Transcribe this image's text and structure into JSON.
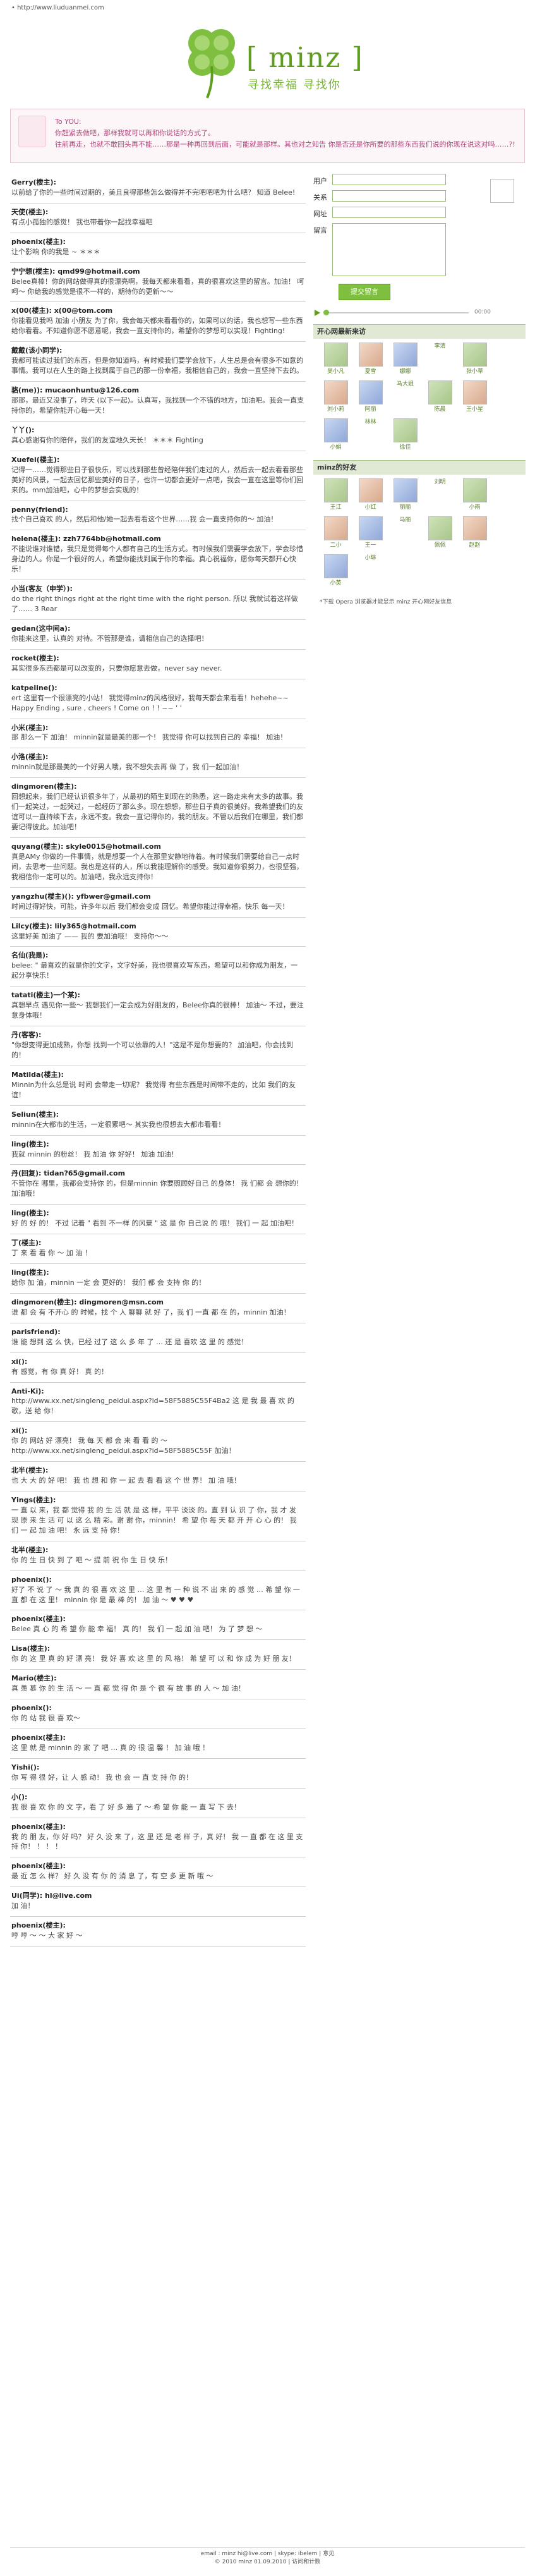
{
  "site": {
    "url": "• http://www.liuduanmei.com",
    "brand": "[ minz ]",
    "slogan": "寻找幸福 寻找你"
  },
  "notice": {
    "title": "To YOU:",
    "lines": [
      "你赶紧去做吧，那样我就可以再和你说话的方式了。",
      "往前再走，也就不敢回头再不能……那是一种再回到后面，可能就是那样。其也对之知告 你是否还是你所要的那些东西我们说的你现在说这对吗……?!"
    ]
  },
  "form": {
    "name_label": "用户",
    "email_label": "关系",
    "site_label": "网址",
    "message_label": "留言",
    "submit_label": "提交留言"
  },
  "player": {
    "time": "00:00"
  },
  "friends_title": "开心网最新来访",
  "friends": [
    "吴小凡",
    "夏雪",
    "娜娜",
    "李清",
    "张小草",
    "刘小莉",
    "阿丽",
    "马大姐",
    "陈晨",
    "王小星",
    "小娟",
    "林林",
    "徐佳"
  ],
  "minz_title": "minz的好友",
  "minz_friends": [
    "王江",
    "小红",
    "丽丽",
    "刘明",
    "小雨",
    "二小",
    "王一",
    "马丽",
    "佩佩",
    "赵赵",
    "小英",
    "小琳"
  ],
  "sidenote": "*下载 Opera 浏览器才能显示 minz 开心网好友信息",
  "entries": [
    {
      "who": "Gerry(楼主):",
      "text": "以前给了你的一些时间过期的，美且良得那些怎么做得并不完吧吧吧为什么吧？ 知道 Belee!"
    },
    {
      "who": "天使(楼主):",
      "text": "有点小孤独的感觉！ 我也带着你一起找幸福吧"
    },
    {
      "who": "phoenix(楼主):",
      "text": "让个影响 你的我是 ~ ＊＊＊"
    },
    {
      "who": "宁宁想(楼主): qmd99@hotmail.com",
      "text": "Belee真棒！你的网站做得真的很漂亮啊，我每天都来看看，真的很喜欢这里的留言。加油！ 呵呵～ 你给我的感觉是很不一样的，期待你的更新～～"
    },
    {
      "who": "x(00(楼主): x(00@tom.com",
      "text": "你能看见我吗 加油 小朋友 为了你，我会每天都来看看你的，如果可以的话，我也想写一些东西给你看看。不知道你愿不愿意呢，我会一直支持你的，希望你的梦想可以实现！Fighting!"
    },
    {
      "who": "戴戴(该小同学):",
      "text": "我都可能读过我们的东西，但是你知道吗，有时候我们要学会放下，人生总是会有很多不如意的事情。我可以在人生的路上找到属于自己的那一份幸福，我相信自己的，我会一直坚持下去的。"
    },
    {
      "who": "骆(me)):  mucaonhuntu@126.com",
      "text": "那那，最近又没事了，昨天 (以下一起)。认真写，我找到一个不错的地方，加油吧。我会一直支持你的，希望你能开心每一天！"
    },
    {
      "who": "丫丫():",
      "text": "真心感谢有你的陪伴，我们的友谊地久天长！ ＊＊＊ Fighting"
    },
    {
      "who": "Xuefei(楼主):",
      "text": "记得一……觉得那些日子很快乐，可以找到那些曾经陪伴我们走过的人，然后去一起去看看那些美好的风景，一起去回忆那些美好的日子，也许一切都会更好一点吧，我会一直在这里等你们回来的。mm加油吧，心中的梦想会实现的！"
    },
    {
      "who": "penny(friend):",
      "text": "找个自己喜欢 的人，然后和他/她一起去看看这个世界……我 会一直支持你的～ 加油！"
    },
    {
      "who": "helena(楼主): zzh7764bb@hotmail.com",
      "text": "不能说谁对谁错，我只是觉得每个人都有自己的生活方式。有时候我们需要学会放下，学会珍惜身边的人。你是一个很好的人，希望你能找到属于你的幸福。真心祝福你，愿你每天都开心快乐！"
    },
    {
      "who": "小当(客友（申学）):",
      "text": "do the right things right at the right time with the right person. 所以 我就试着这样做了…… 3 Rear"
    },
    {
      "who": "gedan(这中间a):",
      "text": "你能来这里，认真的 对待。不管那是谁，请相信自己的选择吧！"
    },
    {
      "who": "rocket(楼主):",
      "text": "其实很多东西都是可以改变的，只要你愿意去做，never say never."
    },
    {
      "who": "katpeline(): ",
      "text": "ert 这里有一个很漂亮的小站！ 我觉得minz的风格很好，我每天都会来看看！hehehe~~ Happy Ending , sure , cheers ! Come on ! ! ~~ ' '"
    },
    {
      "who": "小米(楼主):",
      "text": "那 那么一下 加油！ minnin就是最美的那一个！ 我觉得 你可以找到自己的 幸福！ 加油！"
    },
    {
      "who": "小洛(楼主):",
      "text": "minnin就是那最美的一个好男人哦，我不想失去再 做 了，我 们一起加油！"
    },
    {
      "who": "dingmoren(楼主):",
      "text": "回想起来，我们已经认识很多年了，从最初的陌生到现在的熟悉，这一路走来有太多的故事。我们一起笑过，一起哭过，一起经历了那么多。现在想想，那些日子真的很美好。我希望我们的友谊可以一直持续下去，永远不变。我会一直记得你的，我的朋友。不管以后我们在哪里，我们都要记得彼此。加油吧！"
    },
    {
      "who": "quyang(楼主): skyle0015@hotmail.com",
      "text": "真是AMy 你做的一件事情，就是想要一个人在那里安静地待着。有时候我们需要给自己一点时间，去思考一些问题。我也是这样的人，所以我能理解你的感受。我知道你很努力，也很坚强，我相信你一定可以的。加油吧，我永远支持你！"
    },
    {
      "who": "yangzhu(楼主)(): yfbwer@gmail.com",
      "text": "时间过得好快，可能，许多年以后 我们都会变成 回忆。希望你能过得幸福，快乐 每一天！"
    },
    {
      "who": "Lilcy(楼主): lily365@hotmail.com",
      "text": "这里好美 加油了 —— 我的 要加油哦！ 支持你～～"
    },
    {
      "who": "名仙(我是):",
      "text": "belee: \" 最喜欢的就是你的文字，文字好美，我也很喜欢写东西，希望可以和你成为朋友，一起分享快乐！"
    },
    {
      "who": "tatati(楼主)一个某):",
      "text": "真想早点 遇见你一些～ 我想我们一定会成为好朋友的，Belee你真的很棒！ 加油～ 不过，要注意身体哦！"
    },
    {
      "who": "丹(客客):",
      "text": "\"你想变得更加成熟，你想 找到一个可以依靠的人！\"这是不是你想要的？ 加油吧，你会找到的！"
    },
    {
      "who": "Matilda(楼主):",
      "text": "Minnin为什么总是说 时间 会带走一切呢？ 我觉得 有些东西是时间带不走的，比如 我们的友谊！"
    },
    {
      "who": "Seliun(楼主):",
      "text": "minnin在大都市的生活，一定很累吧～ 其实我也很想去大都市看看！"
    },
    {
      "who": "ling(楼主):",
      "text": "我就 minnin 的粉丝！ 我 加油 你 好好！ 加油 加油！"
    },
    {
      "who": "丹(回复): tidan?65@gmail.com",
      "text": "不管你在 哪里，我都会支持你 的，但是minnin 你要照顾好自己 的身体！ 我 们都 会 想你的！ 加油哦！"
    },
    {
      "who": "ling(楼主):",
      "text": "好 的 好 的！ 不过 记着 \" 看到 不一样 的风景 \" 这 是 你 自己说 的 哦！ 我们 一 起 加油吧！"
    },
    {
      "who": "丁(楼主):",
      "text": "丁 来 看 看 你 ～ 加 油 ！"
    },
    {
      "who": "ling(楼主):",
      "text": "给你 加 油，minnin 一定 会 更好的！ 我们 都 会 支持 你 的！"
    },
    {
      "who": "dingmoren(楼主): dingmoren@msn.com",
      "text": "谁 都 会 有 不开心 的 时候，找 个 人 聊聊 就 好 了，我 们 一直 都 在 的，minnin 加油！"
    },
    {
      "who": "parisfriend):",
      "text": "谁 能 想到 这 么 快，已经 过了 这 么 多 年 了 … 还 是 喜欢 这 里 的 感觉！"
    },
    {
      "who": "xi():",
      "text": "有 感觉，有 你 真 好！ 真 的！"
    },
    {
      "who": "Anti-Ki):",
      "text": "http://www.xx.net/singleng_peidui.aspx?id=58F5885C55F4Ba2 这 是 我 最 喜 欢 的 歌，送 给 你！"
    },
    {
      "who": "xi():",
      "text": "你 的 网站 好 漂亮！ 我 每 天 都 会 来 看 看 的 ～ http://www.xx.net/singleng_peidui.aspx?id=58F5885C55F 加油！"
    },
    {
      "who": "北半(楼主):",
      "text": "也 大 大 的 好 吧！ 我 也 想 和 你 一 起 去 看 看 这 个 世 界！ 加 油 哦！"
    },
    {
      "who": "Yings(楼主):",
      "text": "一 直 以 来，我 都 觉得 我 的 生 活 就 是 这 样，平平 淡淡 的。直 到 认 识 了 你，我 才 发 现 原 来 生 活 可 以 这 么 精 彩。谢 谢 你，minnin！ 希 望 你 每 天 都 开 开 心 心 的！ 我 们 一 起 加 油 吧！ 永 远 支 持 你！"
    },
    {
      "who": "北半(楼主):",
      "text": "你 的 生 日 快 到 了 吧 ～ 提 前 祝 你 生 日 快 乐！"
    },
    {
      "who": "phoenix():",
      "text": "好了 不 说 了 ～ 我 真 的 很 喜 欢 这 里 … 这 里 有 一 种 说 不 出 来 的 感 觉 … 希 望 你 一 直 都 在 这 里！ minnin 你 是 最 棒 的！ 加 油 ～ ♥ ♥ ♥"
    },
    {
      "who": "phoenix(楼主):",
      "text": "Belee 真 心 的 希 望 你 能 幸 福！ 真 的！ 我 们 一 起 加 油 吧！ 为 了 梦 想 ～"
    },
    {
      "who": "Lisa(楼主):",
      "text": "你 的 这 里 真 的 好 漂 亮！ 我 好 喜 欢 这 里 的 风 格！ 希 望 可 以 和 你 成 为 好 朋 友！"
    },
    {
      "who": "Mario(楼主):",
      "text": "真 羡 慕 你 的 生 活 ～ 一 直 都 觉 得 你 是 个 很 有 故 事 的 人 ～ 加 油！"
    },
    {
      "who": "phoenix():",
      "text": "你 的 站 我 很 喜 欢～"
    },
    {
      "who": "phoenix(楼主):",
      "text": "这 里 就 是 minnin 的 家 了 吧 … 真 的 很 温 馨 ！ 加 油 哦 ！"
    },
    {
      "who": "Yishi():",
      "text": "你 写 得 很 好，让 人 感 动！ 我 也 会 一 直 支 持 你 的！"
    },
    {
      "who": "小():",
      "text": "我 很 喜 欢 你 的 文 字，看 了 好 多 遍 了 ～ 希 望 你 能 一 直 写 下 去！"
    },
    {
      "who": "phoenix(楼主):",
      "text": "我 的 朋 友，你 好 吗？ 好 久 没 来 了，这 里 还 是 老 样 子，真 好！ 我 一 直 都 在 这 里 支 持 你！ ！ ！ ！"
    },
    {
      "who": "phoenix(楼主):",
      "text": "最 近 怎 么 样？ 好 久 没 有 你 的 消 息 了，有 空 多 更 新 哦 ～"
    },
    {
      "who": "Ui(同学): hl@live.com",
      "text": "加 油！"
    },
    {
      "who": "phoenix(楼主):",
      "text": "哼 哼 ～ ～ 大 家 好 ～"
    }
  ],
  "footer": {
    "line1": "email : minz hi@live.com | skype: ibelem | 意见",
    "line2": "© 2010 minz 01.09.2010 | 访问和计数"
  }
}
